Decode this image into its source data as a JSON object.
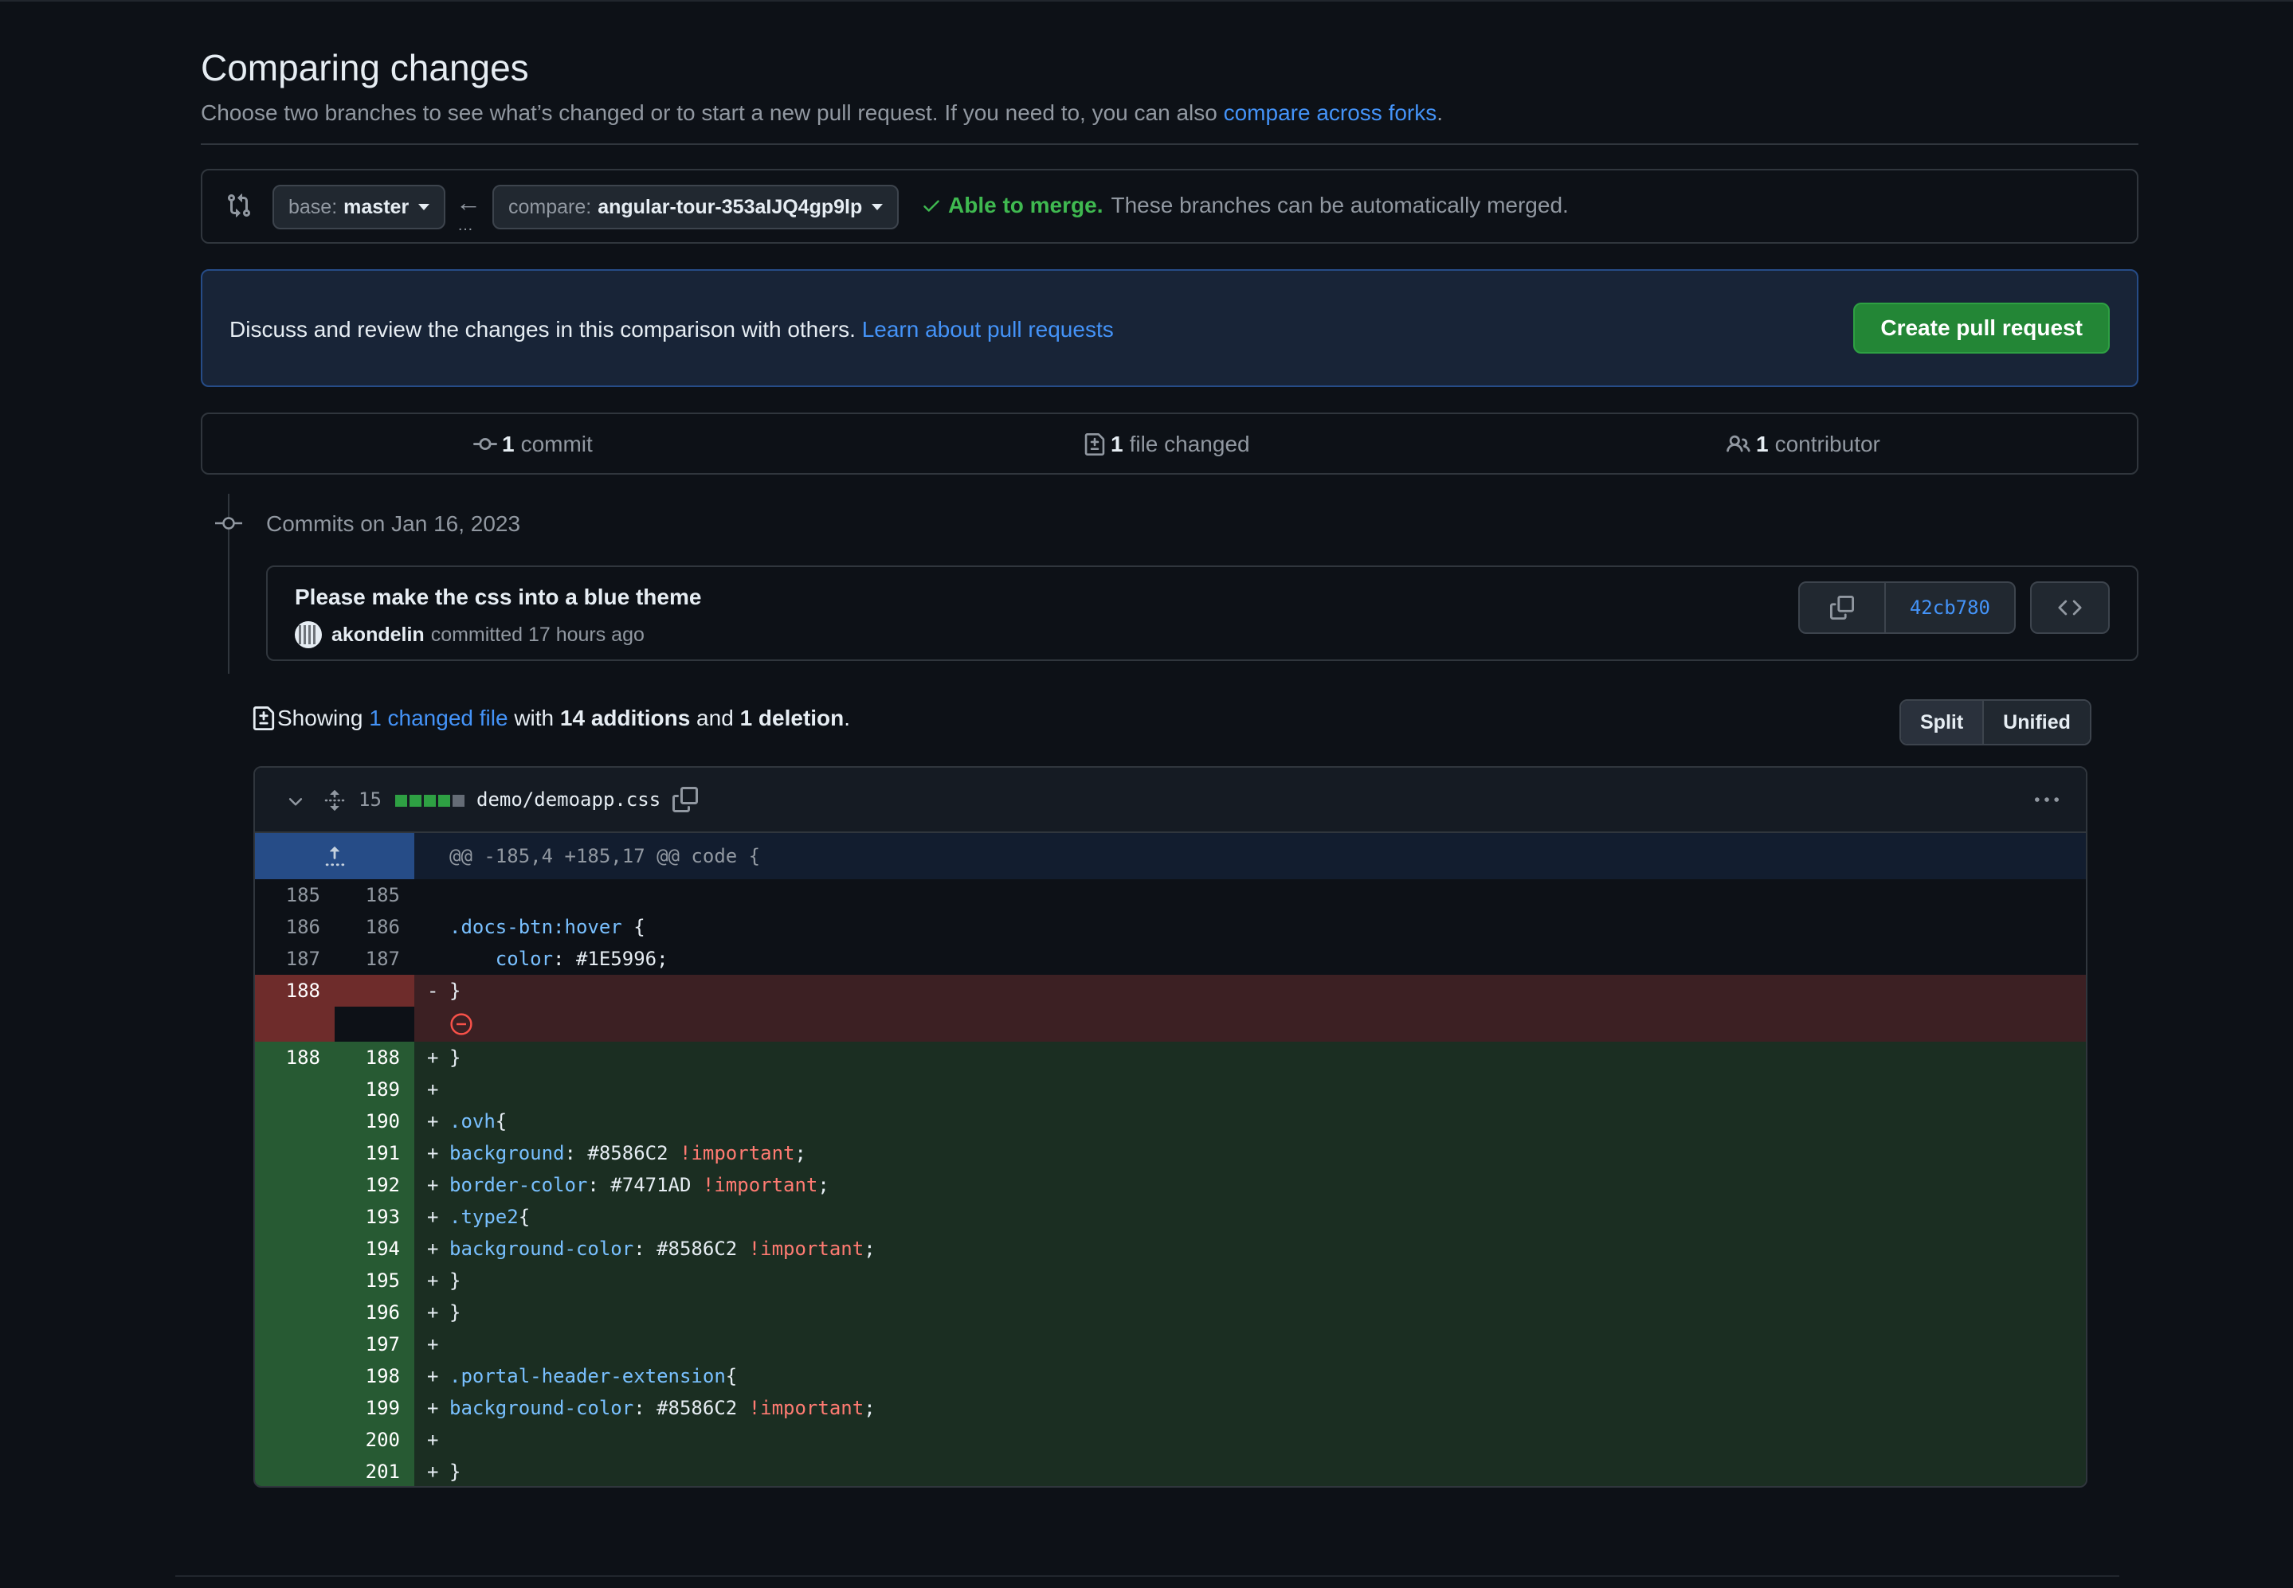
{
  "page": {
    "title": "Comparing changes",
    "subtitle_text": "Choose two branches to see what’s changed or to start a new pull request. If you need to, you can also ",
    "subtitle_link": "compare across forks",
    "subtitle_end": "."
  },
  "range": {
    "base_prefix": "base:",
    "base_branch": "master",
    "compare_prefix": "compare:",
    "compare_branch": "angular-tour-353aIJQ4gp9lp",
    "merge_ok": "Able to merge.",
    "merge_rest": "These branches can be automatically merged."
  },
  "banner": {
    "text": "Discuss and review the changes in this comparison with others. ",
    "link": "Learn about pull requests",
    "create_button": "Create pull request"
  },
  "summary": {
    "commits_count": "1",
    "commits_label": "commit",
    "files_count": "1",
    "files_label": "file changed",
    "contributors_count": "1",
    "contributors_label": "contributor"
  },
  "commits": {
    "date_label": "Commits on Jan 16, 2023",
    "title": "Please make the css into a blue theme",
    "author": "akondelin",
    "meta": "committed 17 hours ago",
    "sha": "42cb780"
  },
  "showing": {
    "prefix": "Showing ",
    "files_link": "1 changed file",
    "with": " with ",
    "additions": "14 additions",
    "and": " and ",
    "deletions": "1 deletion",
    "end": "."
  },
  "view_toggle": {
    "split": "Split",
    "unified": "Unified"
  },
  "file": {
    "changes": "15",
    "path": "demo/demoapp.css",
    "hunk": "@@ -185,4 +185,17 @@ code {",
    "lines": [
      {
        "old": "185",
        "new": "185",
        "type": "ctx",
        "sign": " ",
        "text": ""
      },
      {
        "old": "186",
        "new": "186",
        "type": "ctx",
        "sign": " ",
        "text": ".docs-btn:hover {"
      },
      {
        "old": "187",
        "new": "187",
        "type": "ctx",
        "sign": " ",
        "text": "    color: #1E5996;"
      },
      {
        "old": "188",
        "new": "",
        "type": "del",
        "sign": "-",
        "text": "}"
      },
      {
        "old": "188",
        "new": "188",
        "type": "add",
        "sign": "+",
        "text": "}"
      },
      {
        "old": "",
        "new": "189",
        "type": "add",
        "sign": "+",
        "text": ""
      },
      {
        "old": "",
        "new": "190",
        "type": "add",
        "sign": "+",
        "text": ".ovh{"
      },
      {
        "old": "",
        "new": "191",
        "type": "add",
        "sign": "+",
        "text": "background: #8586C2 !important;"
      },
      {
        "old": "",
        "new": "192",
        "type": "add",
        "sign": "+",
        "text": "border-color: #7471AD !important;"
      },
      {
        "old": "",
        "new": "193",
        "type": "add",
        "sign": "+",
        "text": ".type2{"
      },
      {
        "old": "",
        "new": "194",
        "type": "add",
        "sign": "+",
        "text": "background-color: #8586C2 !important;"
      },
      {
        "old": "",
        "new": "195",
        "type": "add",
        "sign": "+",
        "text": "}"
      },
      {
        "old": "",
        "new": "196",
        "type": "add",
        "sign": "+",
        "text": "}"
      },
      {
        "old": "",
        "new": "197",
        "type": "add",
        "sign": "+",
        "text": ""
      },
      {
        "old": "",
        "new": "198",
        "type": "add",
        "sign": "+",
        "text": ".portal-header-extension{"
      },
      {
        "old": "",
        "new": "199",
        "type": "add",
        "sign": "+",
        "text": "background-color: #8586C2 !important;"
      },
      {
        "old": "",
        "new": "200",
        "type": "add",
        "sign": "+",
        "text": ""
      },
      {
        "old": "",
        "new": "201",
        "type": "add",
        "sign": "+",
        "text": "}"
      }
    ]
  },
  "colors": {
    "accent_blue": "#4493f8",
    "success_green": "#3fb950",
    "button_green": "#238636",
    "deletion_red": "#f85149"
  }
}
